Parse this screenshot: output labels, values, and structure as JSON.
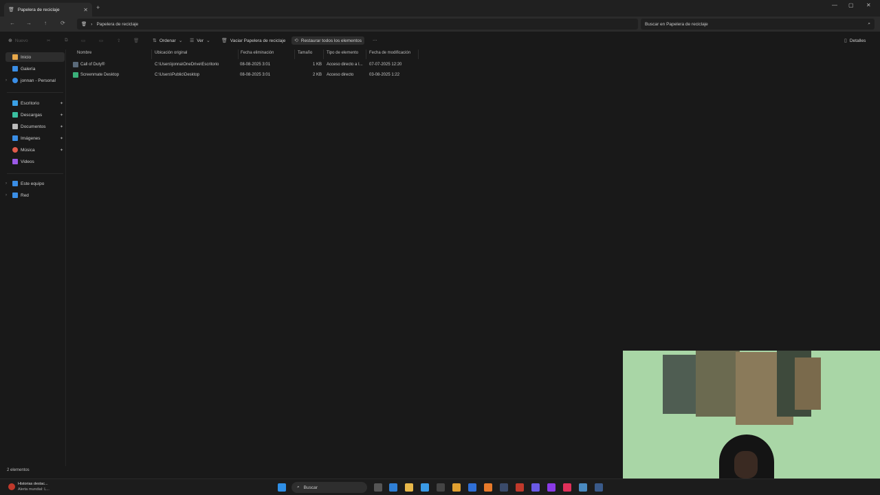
{
  "window": {
    "tab_title": "Papelera de reciclaje",
    "close_tab": "✕",
    "new_tab": "+",
    "minimize": "—",
    "maximize": "▢",
    "close": "✕"
  },
  "addressbar": {
    "back": "←",
    "forward": "→",
    "up": "↑",
    "refresh": "⟳",
    "location_icon": "🗑",
    "chevron": "›",
    "path": "Papelera de reciclaje",
    "search_placeholder": "Buscar en Papelera de reciclaje",
    "search_icon": "⌕"
  },
  "commandbar": {
    "new_label": "Nuevo",
    "sort_label": "Ordenar",
    "view_label": "Ver",
    "empty_label": "Vaciar Papelera de reciclaje",
    "restore_all_label": "Restaurar todos los elementos",
    "more_label": "···",
    "details_label": "Detalles"
  },
  "sidebar": {
    "items": [
      {
        "label": "Inicio",
        "icon": "home-icon",
        "color": "#e8a84a"
      },
      {
        "label": "Galería",
        "icon": "gallery-icon",
        "color": "#3a8ee6"
      },
      {
        "label": "jonnan - Personal",
        "icon": "onedrive-icon",
        "color": "#3a8ee6"
      },
      {
        "label": "Escritorio",
        "icon": "desktop-icon",
        "color": "#3aa0e6"
      },
      {
        "label": "Descargas",
        "icon": "download-icon",
        "color": "#3ac0a0"
      },
      {
        "label": "Documentos",
        "icon": "documents-icon",
        "color": "#bbbbbb"
      },
      {
        "label": "Imágenes",
        "icon": "pictures-icon",
        "color": "#3a8ee6"
      },
      {
        "label": "Música",
        "icon": "music-icon",
        "color": "#e05a4a"
      },
      {
        "label": "Videos",
        "icon": "videos-icon",
        "color": "#9b59e6"
      },
      {
        "label": "Este equipo",
        "icon": "this-pc-icon",
        "color": "#3a8ee6"
      },
      {
        "label": "Red",
        "icon": "network-icon",
        "color": "#3a8ee6"
      }
    ],
    "pin": "✦",
    "chevron": "›"
  },
  "table": {
    "columns": [
      "Nombre",
      "Ubicación original",
      "Fecha eliminación",
      "Tamaño",
      "Tipo de elemento",
      "Fecha de modificación"
    ],
    "rows": [
      {
        "name": "Call of Duty®",
        "location": "C:\\Users\\jonna\\OneDrive\\Escritorio",
        "deleted": "08-08-2025 3:01",
        "size": "1 KB",
        "type": "Acceso directo a I...",
        "modified": "07-07-2025 12:20",
        "icon_color": "#5a6a7a"
      },
      {
        "name": "Screenmate Desktop",
        "location": "C:\\Users\\Public\\Desktop",
        "deleted": "08-08-2025 3:01",
        "size": "2 KB",
        "type": "Acceso directo",
        "modified": "03-08-2025 1:22",
        "icon_color": "#3ab07a"
      }
    ]
  },
  "status": {
    "count": "2 elementos"
  },
  "taskbar": {
    "widget_title": "Historias destac...",
    "widget_subtitle": "Alerta mundial: L...",
    "search_label": "Buscar",
    "search_icon": "⌕"
  }
}
